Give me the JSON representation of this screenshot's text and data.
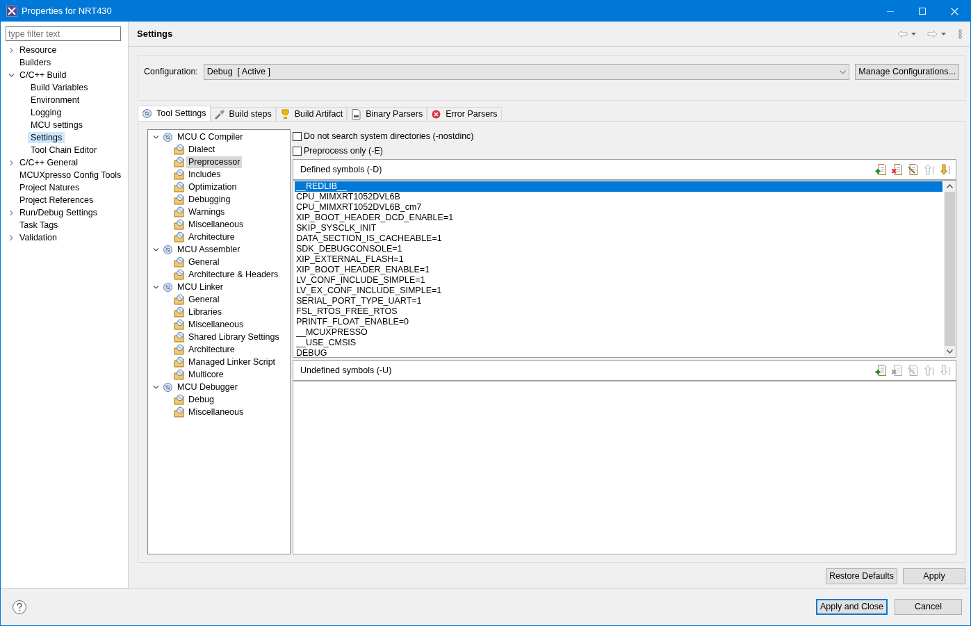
{
  "window": {
    "title": "Properties for NRT430"
  },
  "filter": {
    "placeholder": "type filter text"
  },
  "nav": [
    {
      "label": "Resource",
      "expanded": false,
      "selected": false
    },
    {
      "label": "Builders",
      "selected": false
    },
    {
      "label": "C/C++ Build",
      "expanded": true,
      "selected": false,
      "children": [
        {
          "label": "Build Variables",
          "selected": false
        },
        {
          "label": "Environment",
          "selected": false
        },
        {
          "label": "Logging",
          "selected": false
        },
        {
          "label": "MCU settings",
          "selected": false
        },
        {
          "label": "Settings",
          "selected": true
        },
        {
          "label": "Tool Chain Editor",
          "selected": false
        }
      ]
    },
    {
      "label": "C/C++ General",
      "expanded": false,
      "selected": false
    },
    {
      "label": "MCUXpresso Config Tools",
      "selected": false
    },
    {
      "label": "Project Natures",
      "selected": false
    },
    {
      "label": "Project References",
      "selected": false
    },
    {
      "label": "Run/Debug Settings",
      "expanded": false,
      "selected": false
    },
    {
      "label": "Task Tags",
      "selected": false
    },
    {
      "label": "Validation",
      "expanded": false,
      "selected": false
    }
  ],
  "page": {
    "title": "Settings"
  },
  "configuration": {
    "label": "Configuration:",
    "value": "Debug  [ Active ]",
    "manage_button": "Manage Configurations..."
  },
  "tabs": [
    {
      "label": "Tool Settings",
      "kind": "tool",
      "selected": true
    },
    {
      "label": "Build steps",
      "kind": "steps",
      "selected": false
    },
    {
      "label": "Build Artifact",
      "kind": "artifact",
      "selected": false
    },
    {
      "label": "Binary Parsers",
      "kind": "binary",
      "selected": false
    },
    {
      "label": "Error Parsers",
      "kind": "error",
      "selected": false
    }
  ],
  "tool_tree": [
    {
      "label": "MCU C Compiler",
      "expanded": true,
      "children": [
        {
          "label": "Dialect",
          "selected": false
        },
        {
          "label": "Preprocessor",
          "selected": true
        },
        {
          "label": "Includes",
          "selected": false
        },
        {
          "label": "Optimization",
          "selected": false
        },
        {
          "label": "Debugging",
          "selected": false
        },
        {
          "label": "Warnings",
          "selected": false
        },
        {
          "label": "Miscellaneous",
          "selected": false
        },
        {
          "label": "Architecture",
          "selected": false
        }
      ]
    },
    {
      "label": "MCU Assembler",
      "expanded": true,
      "children": [
        {
          "label": "General",
          "selected": false
        },
        {
          "label": "Architecture & Headers",
          "selected": false
        }
      ]
    },
    {
      "label": "MCU Linker",
      "expanded": true,
      "children": [
        {
          "label": "General",
          "selected": false
        },
        {
          "label": "Libraries",
          "selected": false
        },
        {
          "label": "Miscellaneous",
          "selected": false
        },
        {
          "label": "Shared Library Settings",
          "selected": false
        },
        {
          "label": "Architecture",
          "selected": false
        },
        {
          "label": "Managed Linker Script",
          "selected": false
        },
        {
          "label": "Multicore",
          "selected": false
        }
      ]
    },
    {
      "label": "MCU Debugger",
      "expanded": true,
      "children": [
        {
          "label": "Debug",
          "selected": false
        },
        {
          "label": "Miscellaneous",
          "selected": false
        }
      ]
    }
  ],
  "options": [
    {
      "label": "Do not search system directories (-nostdinc)",
      "checked": false
    },
    {
      "label": "Preprocess only (-E)",
      "checked": false
    }
  ],
  "defined_symbols": {
    "title": "Defined symbols (-D)",
    "toolbar": [
      {
        "kind": "add",
        "disabled": false
      },
      {
        "kind": "delete",
        "disabled": false
      },
      {
        "kind": "edit",
        "disabled": false
      },
      {
        "kind": "up",
        "disabled": true
      },
      {
        "kind": "down",
        "disabled": false
      }
    ],
    "items": [
      {
        "label": "__REDLIB__",
        "selected": true
      },
      {
        "label": "CPU_MIMXRT1052DVL6B",
        "selected": false
      },
      {
        "label": "CPU_MIMXRT1052DVL6B_cm7",
        "selected": false
      },
      {
        "label": "XIP_BOOT_HEADER_DCD_ENABLE=1",
        "selected": false
      },
      {
        "label": "SKIP_SYSCLK_INIT",
        "selected": false
      },
      {
        "label": "DATA_SECTION_IS_CACHEABLE=1",
        "selected": false
      },
      {
        "label": "SDK_DEBUGCONSOLE=1",
        "selected": false
      },
      {
        "label": "XIP_EXTERNAL_FLASH=1",
        "selected": false
      },
      {
        "label": "XIP_BOOT_HEADER_ENABLE=1",
        "selected": false
      },
      {
        "label": "LV_CONF_INCLUDE_SIMPLE=1",
        "selected": false
      },
      {
        "label": "LV_EX_CONF_INCLUDE_SIMPLE=1",
        "selected": false
      },
      {
        "label": "SERIAL_PORT_TYPE_UART=1",
        "selected": false
      },
      {
        "label": "FSL_RTOS_FREE_RTOS",
        "selected": false
      },
      {
        "label": "PRINTF_FLOAT_ENABLE=0",
        "selected": false
      },
      {
        "label": "__MCUXPRESSO",
        "selected": false
      },
      {
        "label": "__USE_CMSIS",
        "selected": false
      },
      {
        "label": "DEBUG",
        "selected": false
      }
    ]
  },
  "undefined_symbols": {
    "title": "Undefined symbols (-U)",
    "toolbar": [
      {
        "kind": "add",
        "disabled": false
      },
      {
        "kind": "delete",
        "disabled": true
      },
      {
        "kind": "edit",
        "disabled": true
      },
      {
        "kind": "up",
        "disabled": true
      },
      {
        "kind": "down",
        "disabled": true
      }
    ]
  },
  "page_buttons": [
    {
      "label": "Restore Defaults",
      "default": false
    },
    {
      "label": "Apply",
      "default": false
    }
  ],
  "dialog_buttons": [
    {
      "label": "Apply and Close",
      "default": true
    },
    {
      "label": "Cancel",
      "default": false
    }
  ]
}
